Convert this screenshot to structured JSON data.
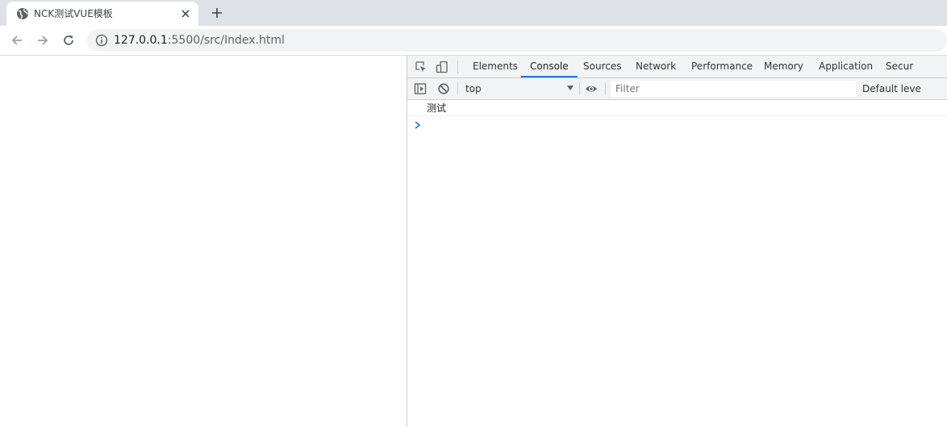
{
  "browser": {
    "tab": {
      "title": "NCK测试VUE模板"
    },
    "url": {
      "host": "127.0.0.1",
      "rest": ":5500/src/Index.html"
    }
  },
  "devtools": {
    "tabs": [
      "Elements",
      "Console",
      "Sources",
      "Network",
      "Performance",
      "Memory",
      "Application",
      "Secur"
    ],
    "active_tab": "Console",
    "console": {
      "context": "top",
      "filter_placeholder": "Filter",
      "levels_label": "Default leve",
      "messages": [
        "测试"
      ]
    }
  },
  "colors": {
    "accent": "#1a73e8",
    "tabstrip": "#dee1e6",
    "devtools_bar": "#f1f3f4"
  },
  "icons": {
    "favicon": "globe-icon",
    "close": "close-icon",
    "new_tab": "plus-icon",
    "back": "arrow-left-icon",
    "forward": "arrow-right-icon",
    "reload": "reload-icon",
    "site_info": "info-icon",
    "inspect": "inspect-icon",
    "device": "device-toolbar-icon",
    "sidebar": "sidebar-toggle-icon",
    "clear": "clear-console-icon",
    "live_expression": "eye-icon",
    "prompt": "chevron-right-icon"
  }
}
